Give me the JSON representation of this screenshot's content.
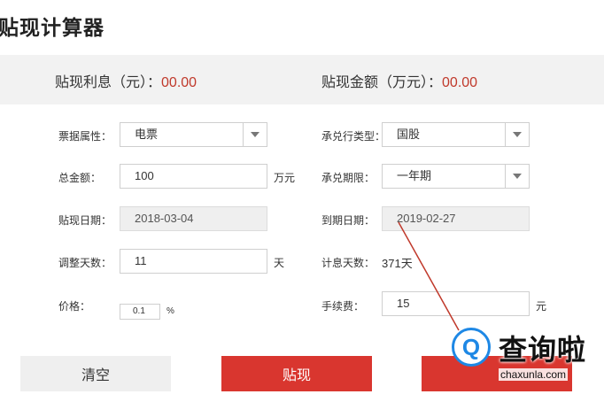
{
  "title": "贴现计算器",
  "summary": {
    "interest_label": "贴现利息（元）：",
    "interest_value": "00.00",
    "amount_label": "贴现金额（万元）：",
    "amount_value": "00.00"
  },
  "form": {
    "bill_type_label": "票据属性：",
    "bill_type_value": "电票",
    "bank_type_label": "承兑行类型：",
    "bank_type_value": "国股",
    "total_label": "总金额：",
    "total_value": "100",
    "total_unit": "万元",
    "term_label": "承兑期限：",
    "term_value": "一年期",
    "discount_date_label": "贴现日期：",
    "discount_date_value": "2018-03-04",
    "due_date_label": "到期日期：",
    "due_date_value": "2019-02-27",
    "adjust_days_label": "调整天数：",
    "adjust_days_value": "11",
    "adjust_days_unit": "天",
    "interest_days_label": "计息天数：",
    "interest_days_value": "371天",
    "price_label": "价格：",
    "price_value": "0.1",
    "price_unit": "%",
    "fee_label": "手续费：",
    "fee_value": "15",
    "fee_unit": "元"
  },
  "buttons": {
    "clear": "清空",
    "discount": "贴现"
  },
  "watermark": {
    "logo_glyph": "Q",
    "text": "查询啦",
    "url": "chaxunla.com"
  },
  "colors": {
    "accent": "#d9362f",
    "value_red": "#c0392b"
  }
}
